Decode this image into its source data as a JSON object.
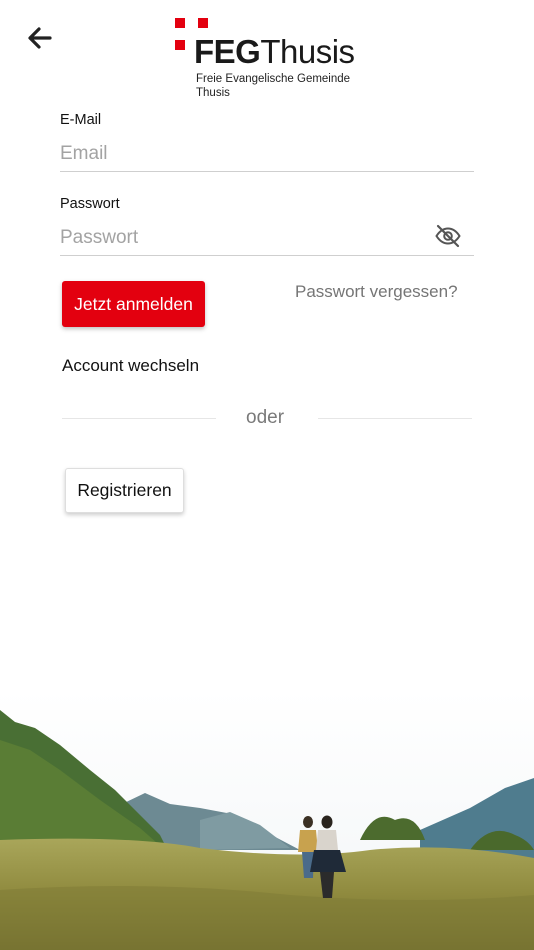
{
  "logo": {
    "name_bold": "FEG",
    "name_regular": "Thusis",
    "subtitle": "Freie Evangelische Gemeinde Thusis",
    "accent_color": "#e3000f"
  },
  "back": {
    "icon": "arrow-left-icon"
  },
  "email": {
    "label": "E-Mail",
    "placeholder": "Email",
    "value": ""
  },
  "password": {
    "label": "Passwort",
    "placeholder": "Passwort",
    "value": "",
    "visibility_icon": "eye-off-icon"
  },
  "actions": {
    "login_label": "Jetzt anmelden",
    "forgot_label": "Passwort vergessen?",
    "switch_account_label": "Account wechseln",
    "divider_label": "oder",
    "register_label": "Registrieren"
  },
  "colors": {
    "primary": "#e3000f",
    "muted_text": "#757575",
    "divider": "#e6e6e6"
  }
}
